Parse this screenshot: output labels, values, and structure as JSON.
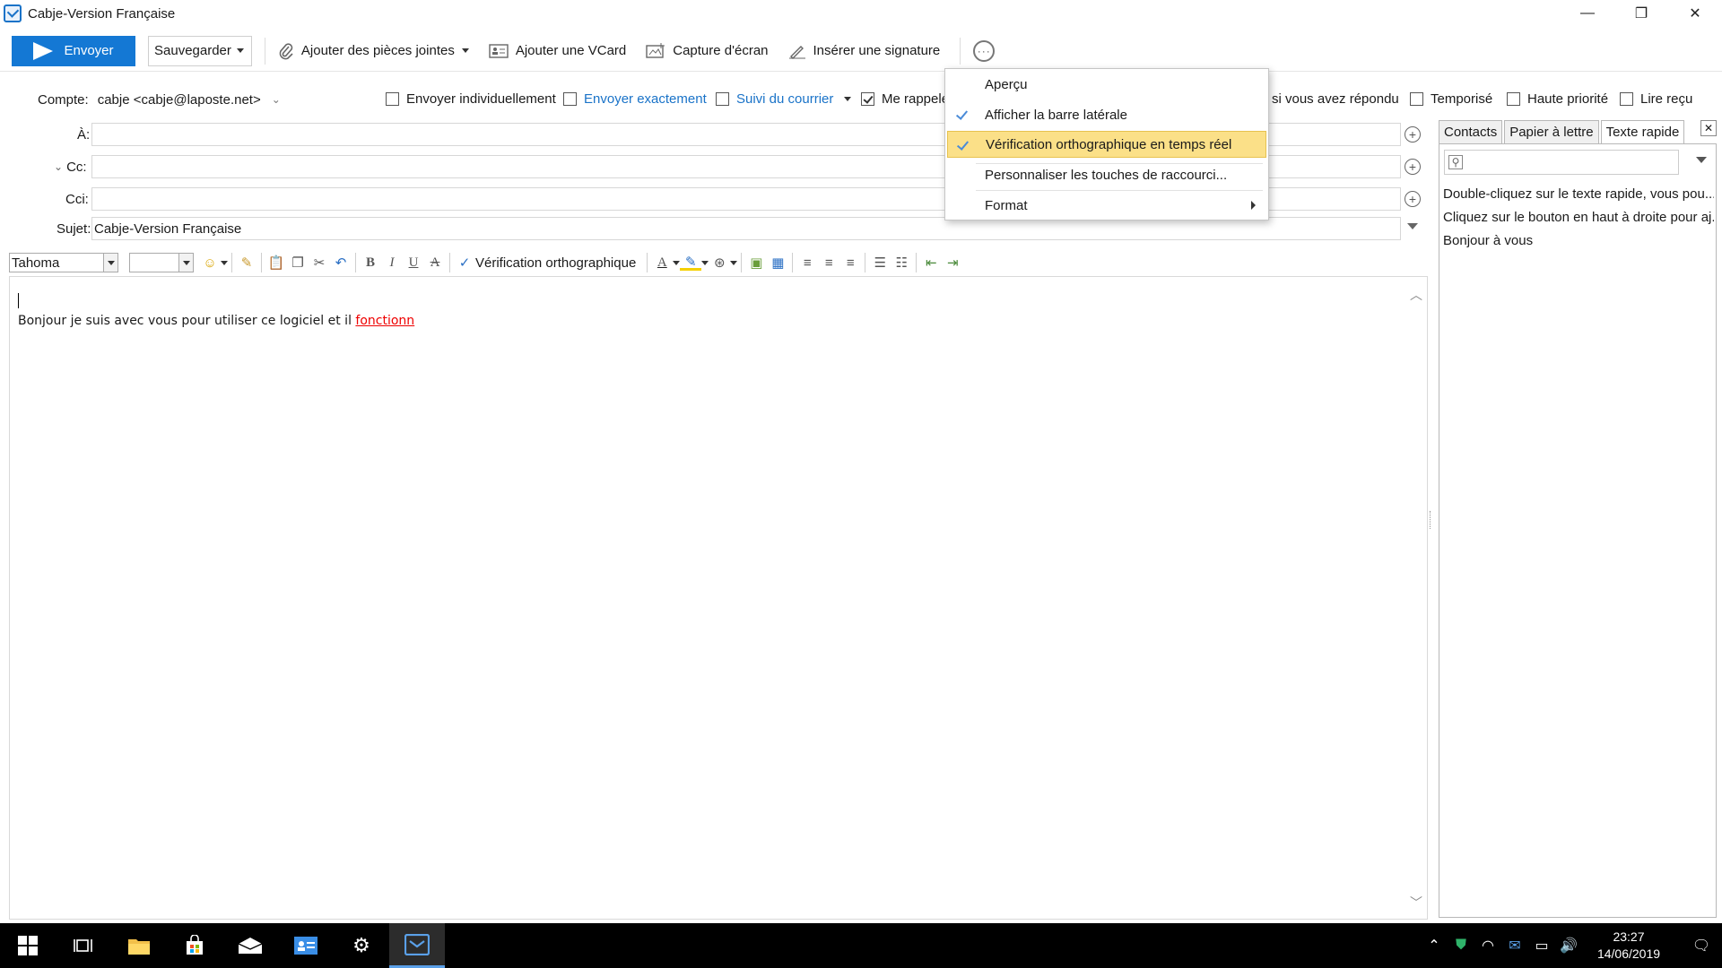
{
  "window": {
    "title": "Cabje-Version Française",
    "minimize": "—",
    "restore": "❐",
    "close": "✕"
  },
  "toolbar": {
    "send": "Envoyer",
    "save": "Sauvegarder",
    "attach": "Ajouter des pièces jointes",
    "vcard": "Ajouter une VCard",
    "screenshot": "Capture d'écran",
    "signature": "Insérer une signature",
    "more": "···"
  },
  "account": {
    "label": "Compte:",
    "value": "cabje <cabje@laposte.net>"
  },
  "options": {
    "send_individually": "Envoyer individuellement",
    "send_exactly": "Envoyer exactement",
    "track": "Suivi du courrier",
    "remind": "Me rappele",
    "if_replied": "si vous avez répondu",
    "delayed": "Temporisé",
    "high_priority": "Haute priorité",
    "read_receipt": "Lire reçu",
    "remind_checked": true
  },
  "fields": {
    "to_label": "À:",
    "cc_label": "Cc:",
    "bcc_label": "Cci:",
    "subject_label": "Sujet:",
    "subject_value": "Cabje-Version Française"
  },
  "format_bar": {
    "font": "Tahoma",
    "spell": "Vérification orthographique"
  },
  "editor": {
    "text_before": "Bonjour je suis avec vous pour utiliser ce logiciel et il ",
    "misspelled": "fonctionn"
  },
  "sidebar": {
    "tabs": [
      "Contacts",
      "Papier à lettre",
      "Texte rapide"
    ],
    "active_tab": 2,
    "items": [
      "Double-cliquez sur le texte rapide, vous pou...",
      "Cliquez sur le bouton en haut à droite pour aj...",
      "Bonjour à vous"
    ]
  },
  "menu": {
    "items": [
      {
        "label": "Aperçu",
        "checked": false
      },
      {
        "label": "Afficher la barre latérale",
        "checked": true
      },
      {
        "label": "Vérification orthographique en temps réel",
        "checked": true,
        "highlighted": true
      },
      {
        "label": "Personnaliser les touches de raccourci...",
        "checked": false
      },
      {
        "label": "Format",
        "checked": false,
        "submenu": true
      }
    ]
  },
  "taskbar": {
    "time": "23:27",
    "date": "14/06/2019"
  },
  "colors": {
    "accent": "#1478d4",
    "highlight": "#fbe088",
    "misspell": "#e00000"
  }
}
